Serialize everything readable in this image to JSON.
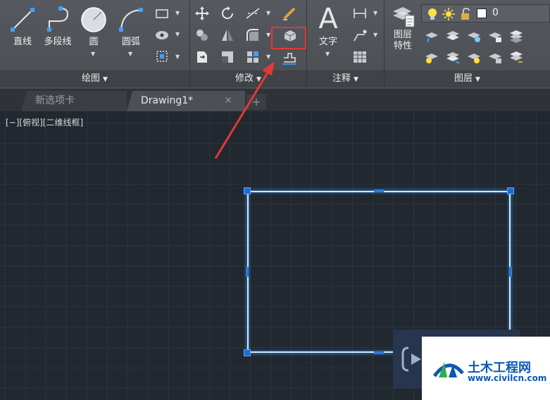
{
  "ribbon": {
    "draw_panel": {
      "title": "绘图",
      "line_label": "直线",
      "polyline_label": "多段线",
      "circle_label": "圆",
      "arc_label": "圆弧"
    },
    "modify_panel": {
      "title": "修改"
    },
    "annotation_panel": {
      "title": "注释",
      "text_label": "文字"
    },
    "layers_panel": {
      "title": "图层",
      "layer_props_label_1": "图层",
      "layer_props_label_2": "特性",
      "current_layer": "0"
    }
  },
  "tabs": [
    {
      "label": "新选项卡",
      "active": false
    },
    {
      "label": "Drawing1*",
      "active": true
    }
  ],
  "viewport": {
    "label": "[−][俯视][二维线框]"
  },
  "watermark": {
    "title": "土木工程网",
    "url": "www.civilcn.com"
  },
  "colors": {
    "ribbon_bg": "#4f5258",
    "canvas_bg": "#212830",
    "grip_blue": "#1f6cd6",
    "highlight_red": "#e03a36",
    "brand_blue": "#0a58b3"
  },
  "icons": {
    "highlighted_tool": "3d-box-icon",
    "arrow": "red-callout-arrow"
  }
}
